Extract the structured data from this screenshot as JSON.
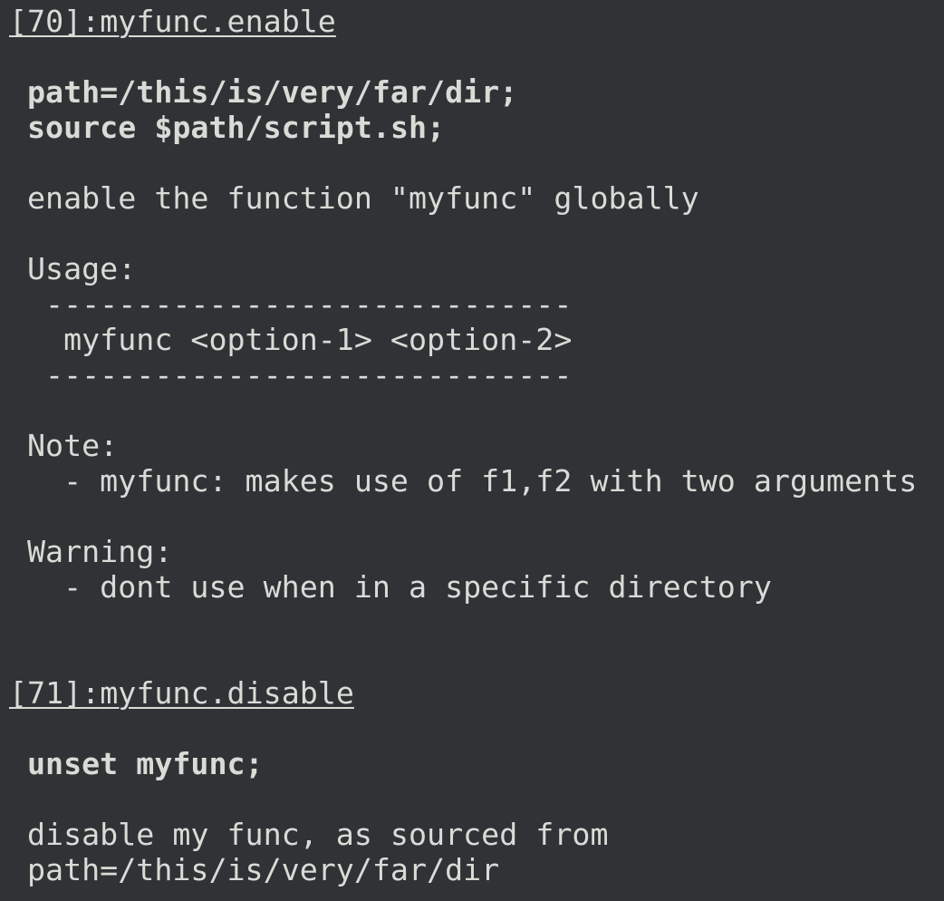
{
  "entries": [
    {
      "title": "[70]:myfunc.enable",
      "commands": [
        "path=/this/is/very/far/dir;",
        "source $path/script.sh;"
      ],
      "description": "enable the function \"myfunc\" globally",
      "usage_label": "Usage:",
      "usage_rule_top": " -----------------------------",
      "usage_text": "  myfunc <option-1> <option-2>",
      "usage_rule_bottom": " -----------------------------",
      "note_label": "Note:",
      "note_item": "  - myfunc: makes use of f1,f2 with two arguments",
      "warning_label": "Warning:",
      "warning_item": "  - dont use when in a specific directory"
    },
    {
      "title": "[71]:myfunc.disable",
      "commands": [
        "unset myfunc;"
      ],
      "description_lines": [
        "disable my func, as sourced from",
        "path=/this/is/very/far/dir"
      ]
    }
  ]
}
